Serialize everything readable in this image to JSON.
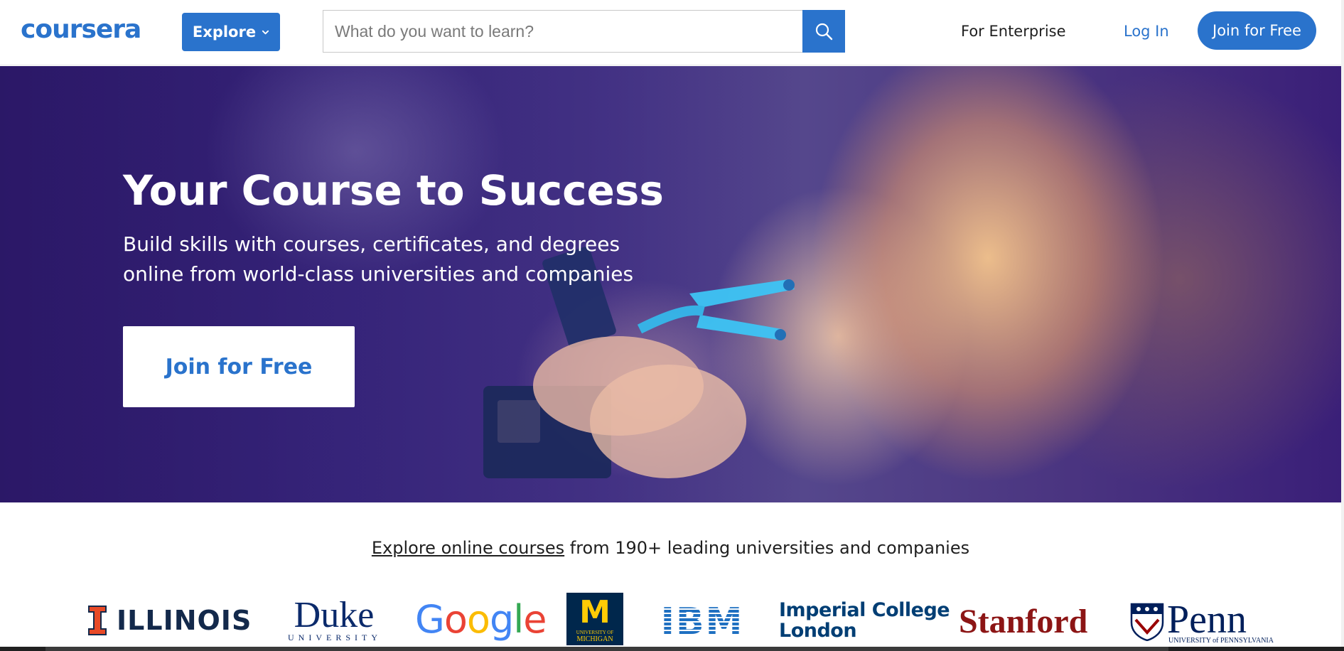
{
  "header": {
    "logo_text": "coursera",
    "explore_label": "Explore",
    "search": {
      "placeholder": "What do you want to learn?"
    },
    "nav": {
      "enterprise": "For Enterprise",
      "login": "Log In",
      "join": "Join for Free"
    }
  },
  "hero": {
    "title": "Your Course to Success",
    "subtitle_line1": "Build skills with courses, certificates, and degrees",
    "subtitle_line2": "online from world-class universities and companies",
    "cta": "Join for Free"
  },
  "partners": {
    "link_text": "Explore online courses",
    "rest_text": " from 190+ leading universities and companies",
    "logos": {
      "illinois": "ILLINOIS",
      "duke": "Duke",
      "duke_sub": "UNIVERSITY",
      "google": "Google",
      "michigan_mark": "M",
      "michigan_sub1": "UNIVERSITY OF",
      "michigan_sub2": "MICHIGAN",
      "ibm": "IBM",
      "imperial_line1": "Imperial College",
      "imperial_line2": "London",
      "stanford": "Stanford",
      "penn": "Penn",
      "penn_sub": "UNIVERSITY of PENNSYLVANIA"
    }
  },
  "colors": {
    "brand_blue": "#2a73cc",
    "hero_purple": "#3e2c86",
    "illinois_orange": "#e84a27",
    "stanford_red": "#8c1515",
    "michigan_blue": "#00274c",
    "michigan_maize": "#ffcb05",
    "ibm_blue": "#1f70c1"
  }
}
